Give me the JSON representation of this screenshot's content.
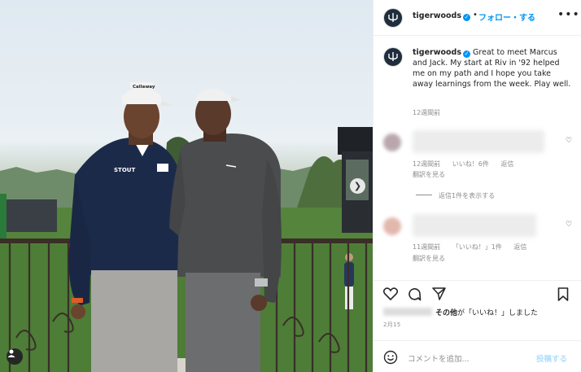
{
  "post": {
    "username": "tigerwoods",
    "follow_label": "フォロー・する",
    "dot": "•",
    "more_label": "•••",
    "caption_username": "tigerwoods",
    "caption_text": "Great to meet Marcus and Jack. My start at Riv in '92 helped me on my path and I hope you take away learnings from the week. Play well.",
    "caption_time": "12週間前",
    "avatar_monogram": "⌂"
  },
  "comments": [
    {
      "time": "12週間前",
      "likes": "いいね！6件",
      "reply": "返信",
      "translate": "翻訳を見る",
      "view_replies": "返信1件を表示する",
      "avatar_color": "#b9a7ad"
    },
    {
      "time": "11週間前",
      "likes": "「いいね！」1件",
      "reply": "返信",
      "translate": "翻訳を見る",
      "avatar_color": "#e2b8ad"
    }
  ],
  "likes_summary": {
    "others_label": "その他",
    "suffix": "が「いいね！」しました"
  },
  "date": "2月15",
  "comment_input": {
    "placeholder": "コメントを追加...",
    "post_label": "投稿する"
  },
  "photo": {
    "cap_left_logo": "Callaway",
    "shirt_sponsor": "STOUT",
    "carousel_next": "❯"
  },
  "colors": {
    "link_blue": "#0095f6",
    "muted": "#8e8e8e",
    "navy_jacket": "#1c2a4a",
    "grey_sweater": "#4a4c4e"
  }
}
